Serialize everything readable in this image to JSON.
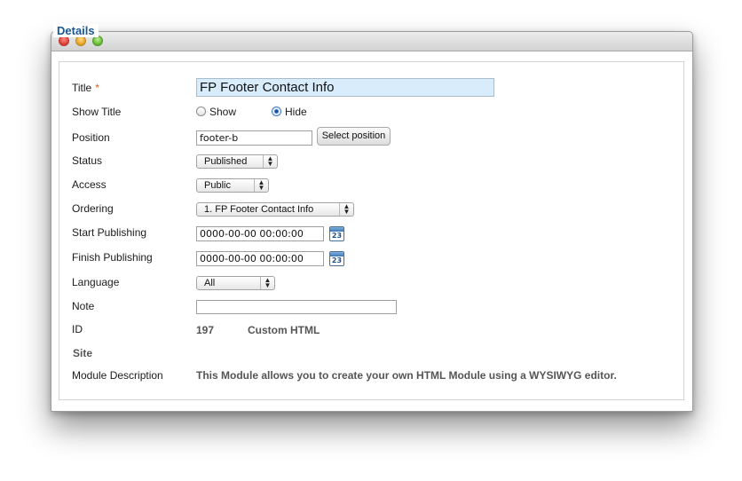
{
  "form": {
    "legend": "Details",
    "title": {
      "label": "Title",
      "required_mark": "*",
      "value": "FP Footer Contact Info"
    },
    "show_title": {
      "label": "Show Title",
      "options": [
        "Show",
        "Hide"
      ],
      "selected": "Hide"
    },
    "position": {
      "label": "Position",
      "value": "footer-b",
      "button": "Select position"
    },
    "status": {
      "label": "Status",
      "value": "Published"
    },
    "access": {
      "label": "Access",
      "value": "Public"
    },
    "ordering": {
      "label": "Ordering",
      "value": "1. FP Footer Contact Info"
    },
    "start_publishing": {
      "label": "Start Publishing",
      "value": "0000-00-00 00:00:00",
      "calendar_day": "23"
    },
    "finish_publishing": {
      "label": "Finish Publishing",
      "value": "0000-00-00 00:00:00",
      "calendar_day": "23"
    },
    "language": {
      "label": "Language",
      "value": "All"
    },
    "note": {
      "label": "Note",
      "value": ""
    },
    "id": {
      "label": "ID",
      "value": "197",
      "type": "Custom HTML"
    },
    "site": {
      "label": "Site"
    },
    "module_description": {
      "label": "Module Description",
      "value": "This Module allows you to create your own HTML Module using a WYSIWYG editor."
    }
  },
  "icons": {
    "window_controls": [
      "close-icon",
      "minimize-icon",
      "zoom-icon"
    ],
    "calendar": "calendar-icon",
    "select_arrows": "updown-arrows-icon"
  },
  "colors": {
    "legend": "#1a5893",
    "required": "#e05a1b",
    "title_input_bg": "#d9ecfb"
  }
}
